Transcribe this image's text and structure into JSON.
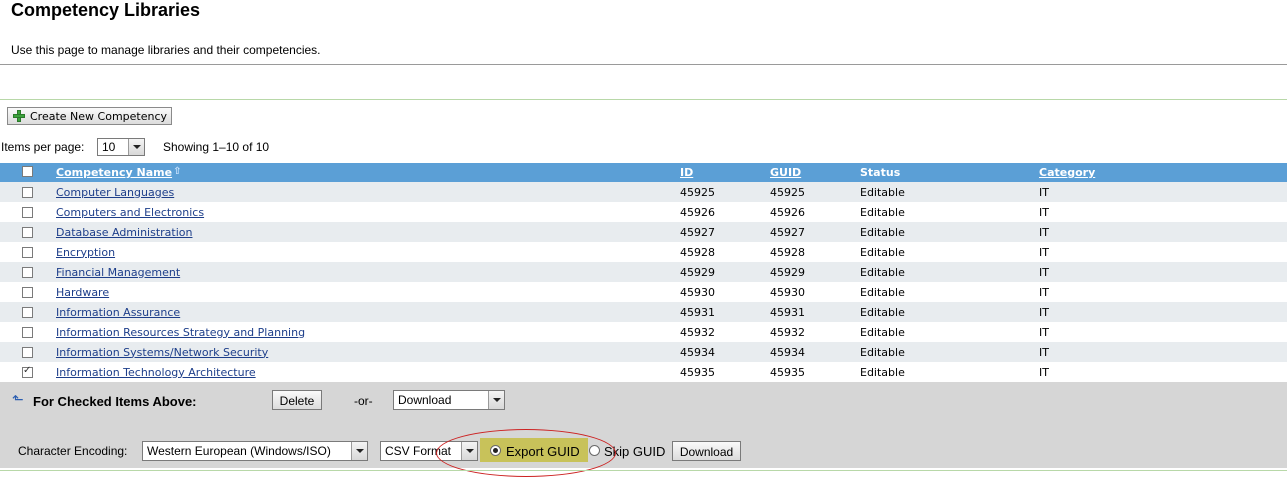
{
  "page": {
    "title": "Competency Libraries",
    "description": "Use this page to manage libraries and their competencies."
  },
  "toolbar": {
    "create_label": "Create New Competency"
  },
  "pagination": {
    "items_per_page_label": "Items per page:",
    "items_per_page_value": "10",
    "showing_text": "Showing 1–10 of 10"
  },
  "table": {
    "headers": {
      "name": "Competency Name",
      "id": "ID",
      "guid": "GUID",
      "status": "Status",
      "category": "Category"
    },
    "rows": [
      {
        "name": "Computer Languages",
        "id": "45925",
        "guid": "45925",
        "status": "Editable",
        "category": "IT",
        "checked": false
      },
      {
        "name": "Computers and Electronics",
        "id": "45926",
        "guid": "45926",
        "status": "Editable",
        "category": "IT",
        "checked": false
      },
      {
        "name": "Database Administration",
        "id": "45927",
        "guid": "45927",
        "status": "Editable",
        "category": "IT",
        "checked": false
      },
      {
        "name": "Encryption",
        "id": "45928",
        "guid": "45928",
        "status": "Editable",
        "category": "IT",
        "checked": false
      },
      {
        "name": "Financial Management",
        "id": "45929",
        "guid": "45929",
        "status": "Editable",
        "category": "IT",
        "checked": false
      },
      {
        "name": "Hardware",
        "id": "45930",
        "guid": "45930",
        "status": "Editable",
        "category": "IT",
        "checked": false
      },
      {
        "name": "Information Assurance",
        "id": "45931",
        "guid": "45931",
        "status": "Editable",
        "category": "IT",
        "checked": false
      },
      {
        "name": "Information Resources Strategy and Planning",
        "id": "45932",
        "guid": "45932",
        "status": "Editable",
        "category": "IT",
        "checked": false
      },
      {
        "name": "Information Systems/Network Security",
        "id": "45934",
        "guid": "45934",
        "status": "Editable",
        "category": "IT",
        "checked": false
      },
      {
        "name": "Information Technology Architecture",
        "id": "45935",
        "guid": "45935",
        "status": "Editable",
        "category": "IT",
        "checked": true
      }
    ]
  },
  "actions": {
    "checked_label": "For Checked Items Above:",
    "delete_label": "Delete",
    "or_label": "-or-",
    "download_select_value": "Download",
    "encoding_label": "Character Encoding:",
    "encoding_value": "Western European (Windows/ISO)",
    "format_value": "CSV Format",
    "export_guid_label": "Export GUID",
    "skip_guid_label": "Skip GUID",
    "download_button_label": "Download"
  },
  "colors": {
    "header_blue": "#5b9fd6",
    "row_alt": "#e8ecef",
    "link": "#1d3e8a",
    "highlight": "#c8c25a",
    "annotation": "#cc2222"
  }
}
